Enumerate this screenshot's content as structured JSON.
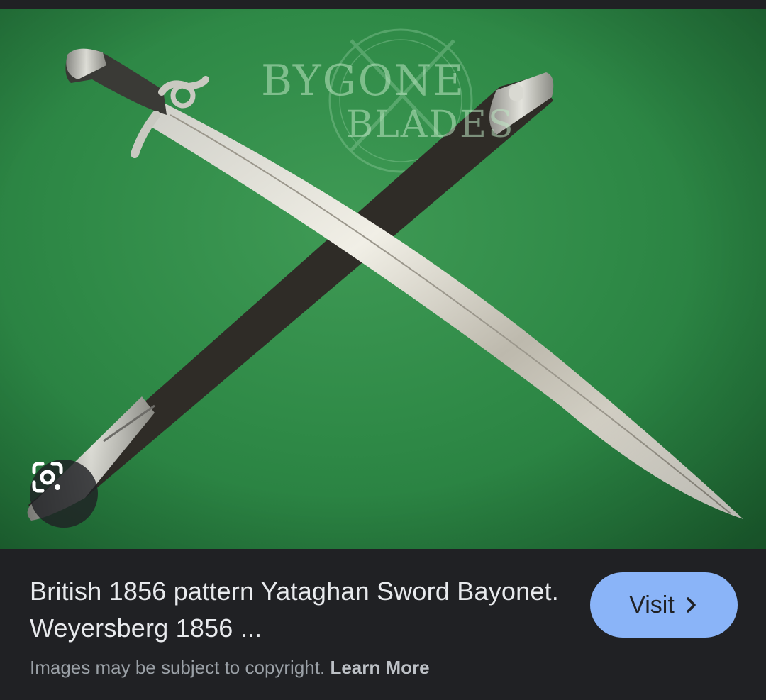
{
  "image": {
    "watermark_line1": "BYGONE",
    "watermark_line2": "BLADES",
    "background_color": "#2f8a47",
    "lens_icon": "google-lens-icon"
  },
  "result": {
    "title": "British 1856 pattern Yataghan Sword Bayonet. Weyersberg 1856 ...",
    "copyright_text": "Images may be subject to copyright.",
    "learn_more_label": "Learn More",
    "visit_label": "Visit",
    "visit_icon": "chevron-right-icon",
    "accent_color": "#8ab4f8"
  }
}
